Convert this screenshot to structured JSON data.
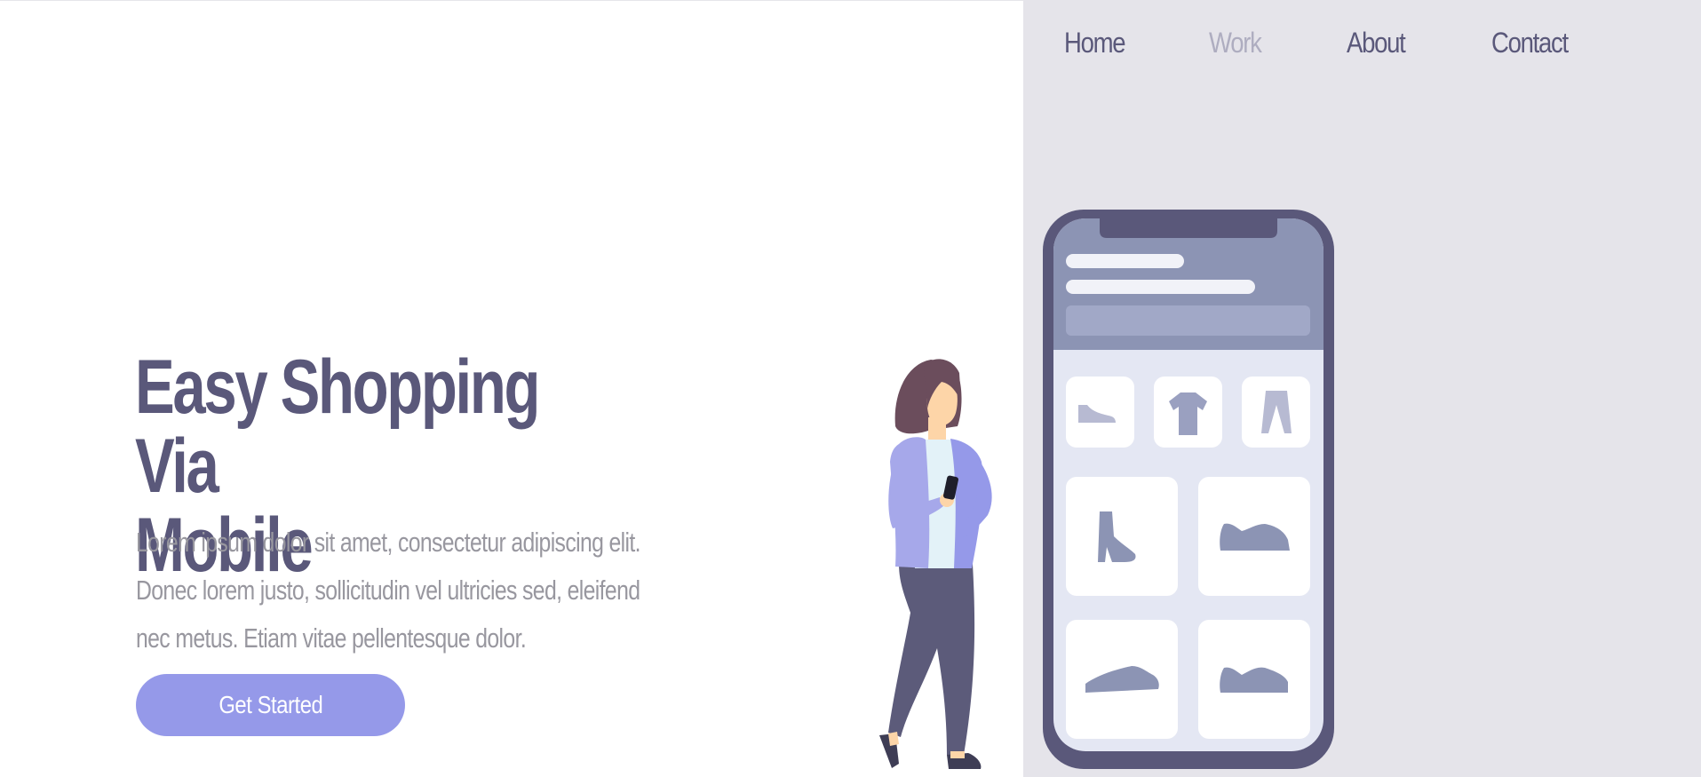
{
  "nav": {
    "items": [
      {
        "label": "Home",
        "active": false
      },
      {
        "label": "Work",
        "active": true
      },
      {
        "label": "About",
        "active": false
      },
      {
        "label": "Contact",
        "active": false
      }
    ]
  },
  "hero": {
    "title_line1": "Easy Shopping Via",
    "title_line2": "Mobile",
    "description_line1": "Lorem ipsum dolor sit amet, consectetur adipiscing elit.",
    "description_line2": "Donec lorem justo, sollicitudin vel ultricies sed, eleifend",
    "description_line3": "nec metus. Etiam vitae pellentesque dolor.",
    "cta_label": "Get Started"
  },
  "phone": {
    "category_icons": [
      "shoe-icon",
      "tshirt-icon",
      "pants-icon"
    ],
    "product_icons": [
      "ankle-boot-icon",
      "sneaker-icon",
      "sneaker-icon",
      "sneaker-icon"
    ]
  },
  "colors": {
    "primary_text": "#5a587a",
    "muted_nav": "#aeadc0",
    "body_text": "#98979f",
    "button": "#9599e9",
    "panel_bg": "#e5e4ea",
    "phone_frame": "#5a587a",
    "phone_header": "#8c94b4",
    "phone_screen": "#e4e7f3"
  }
}
